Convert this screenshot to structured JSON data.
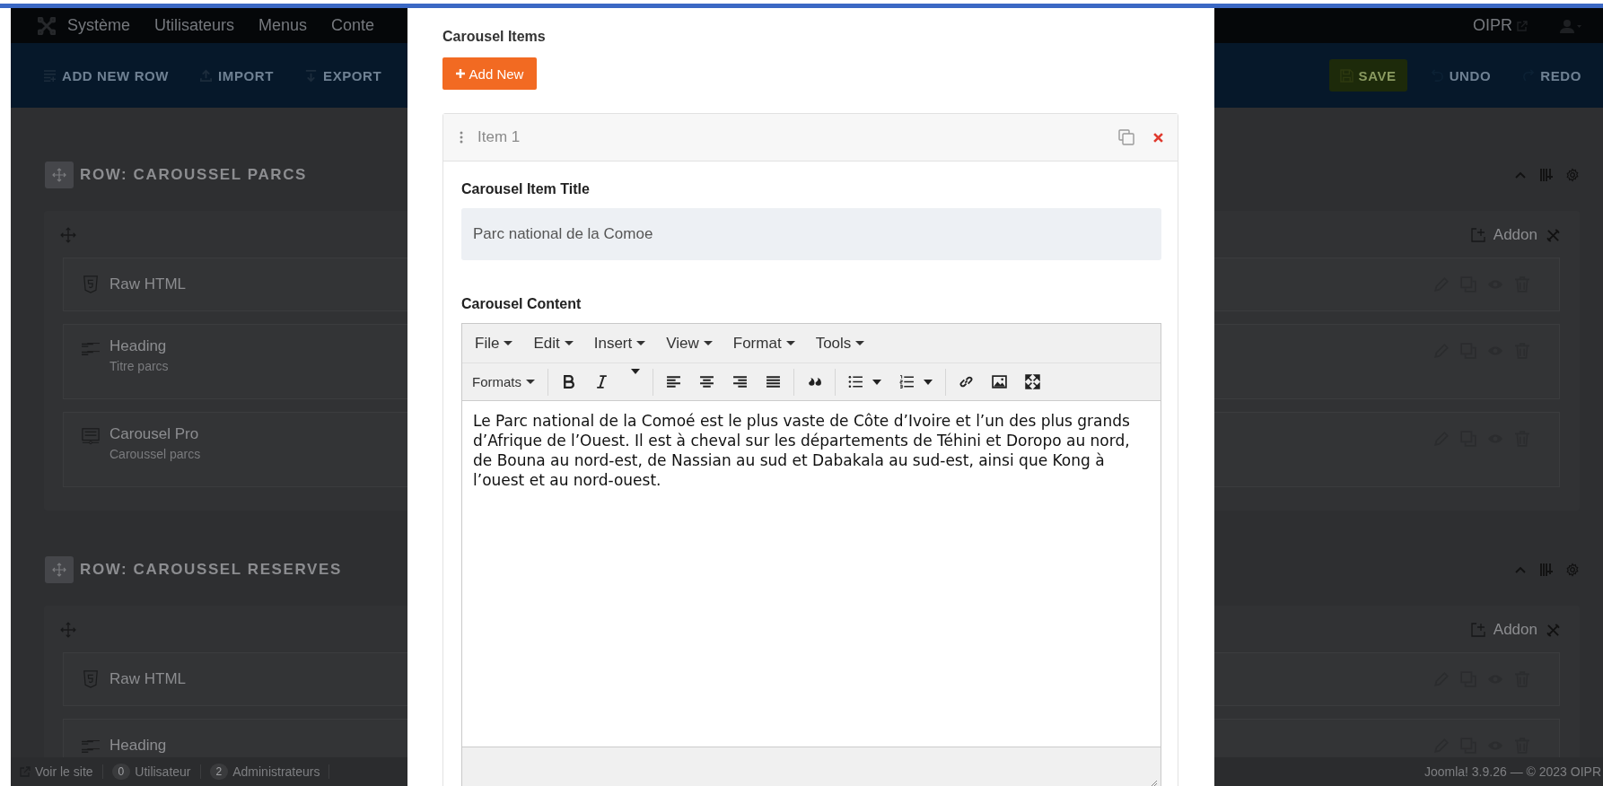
{
  "nav": {
    "menu": [
      "Système",
      "Utilisateurs",
      "Menus",
      "Conte"
    ],
    "site": "OIPR"
  },
  "toolbar": {
    "left": [
      {
        "kind": "add_row",
        "label": "ADD NEW ROW"
      },
      {
        "kind": "import",
        "label": "IMPORT"
      },
      {
        "kind": "export",
        "label": "EXPORT"
      }
    ],
    "right": [
      {
        "kind": "save",
        "label": "SAVE"
      },
      {
        "kind": "undo",
        "label": "UNDO"
      },
      {
        "kind": "redo",
        "label": "REDO"
      }
    ]
  },
  "rows": [
    {
      "title": "ROW: CAROUSSEL PARCS",
      "addon_button": "Addon",
      "addons": [
        {
          "kind": "html",
          "name": "Raw HTML"
        },
        {
          "kind": "heading",
          "name": "Heading",
          "subtitle": "Titre parcs"
        },
        {
          "kind": "carousel",
          "name": "Carousel Pro",
          "subtitle": "Caroussel parcs"
        }
      ]
    },
    {
      "title": "ROW: CAROUSSEL RESERVES",
      "addon_button": "Addon",
      "addons": [
        {
          "kind": "html",
          "name": "Raw HTML"
        },
        {
          "kind": "heading",
          "name": "Heading"
        }
      ]
    }
  ],
  "footer": {
    "items": [
      {
        "kind": "link",
        "label": "Voir le site"
      },
      {
        "kind": "count",
        "count": "0",
        "label": "Utilisateur"
      },
      {
        "kind": "count",
        "count": "2",
        "label": "Administrateurs"
      }
    ],
    "version": "Joomla! 3.9.26 — © 2023 OIPR"
  },
  "modal": {
    "section_title": "Carousel Items",
    "add_button": "Add New",
    "item": {
      "title": "Item 1",
      "title_label": "Carousel Item Title",
      "title_value": "Parc national de la Comoe",
      "content_label": "Carousel Content",
      "editor": {
        "menus": [
          "File",
          "Edit",
          "Insert",
          "View",
          "Format",
          "Tools"
        ],
        "formats": "Formats",
        "content": "Le Parc national de la Comoé est le plus vaste de Côte d’Ivoire et l’un des plus grands d’Afrique de l’Ouest. Il est à cheval sur les départements de Téhini et Doropo au nord, de Bouna au nord-est, de Nassian au sud et Dabakala au sud-est, ainsi que Kong à l’ouest et au nord-ouest."
      }
    }
  }
}
